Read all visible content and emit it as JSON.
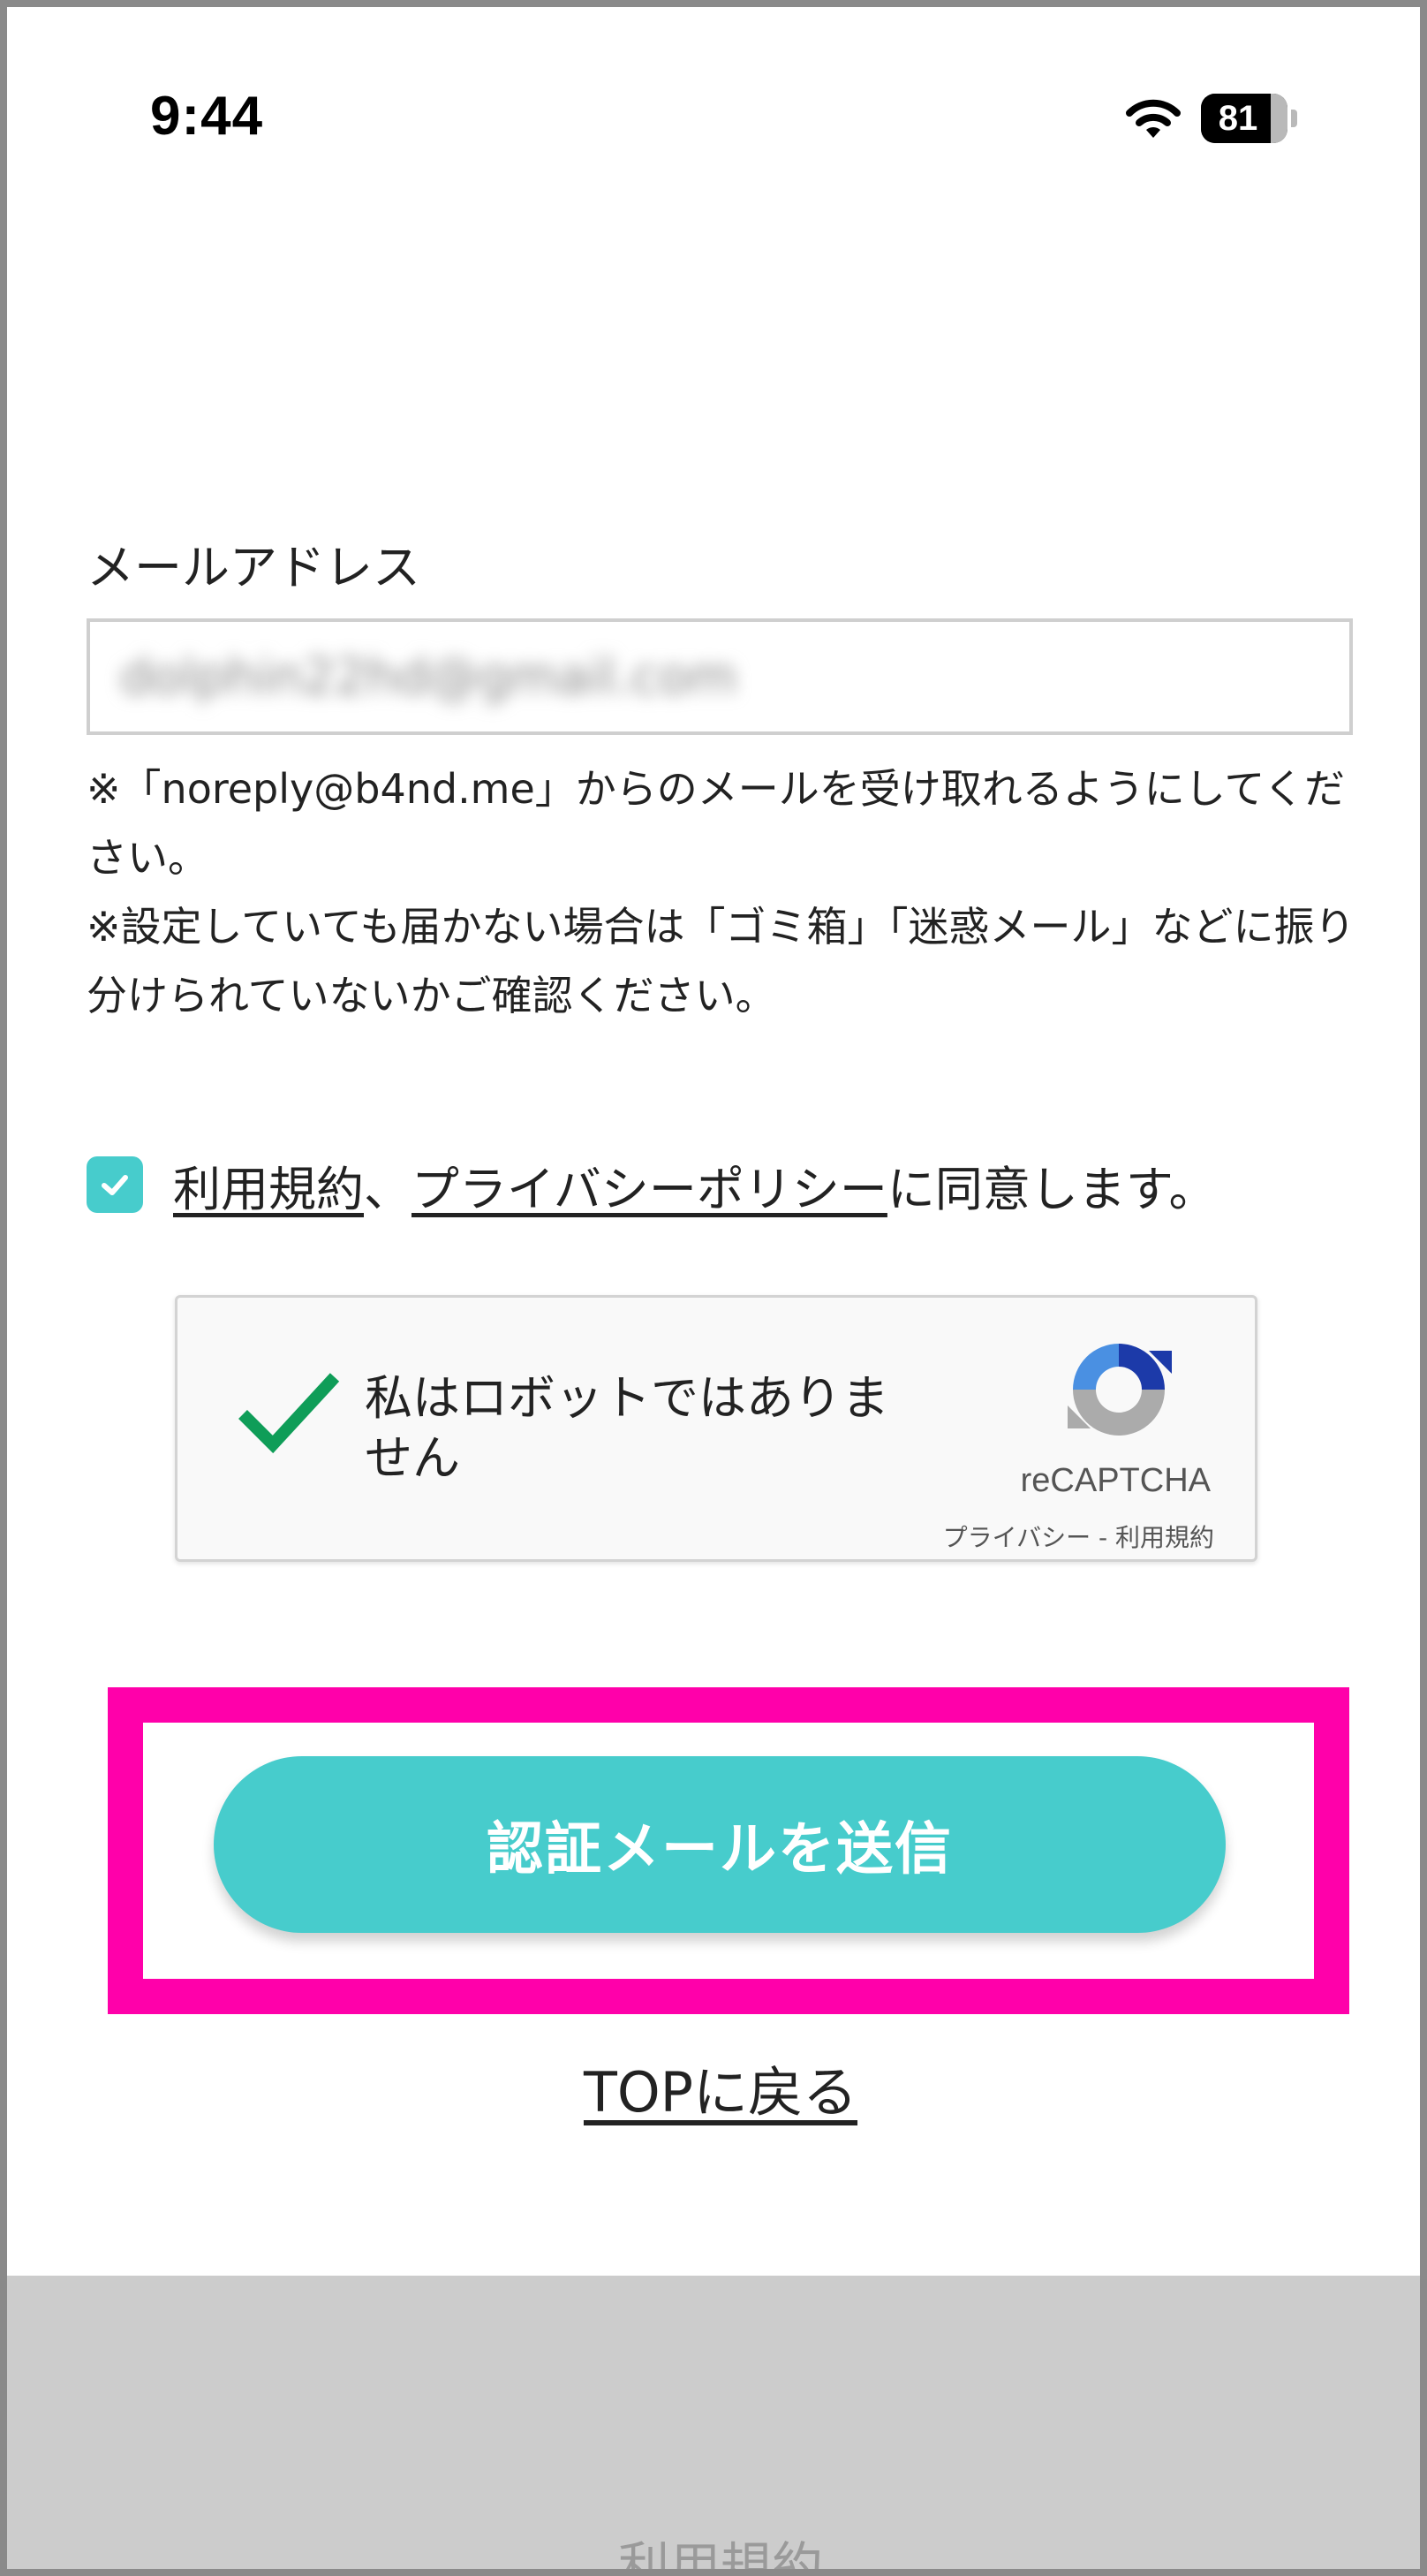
{
  "status_bar": {
    "time": "9:44",
    "battery_level": "81",
    "battery_fraction": 0.81
  },
  "email": {
    "label": "メールアドレス",
    "value": "dolphin22hd@gmail.com"
  },
  "notes": [
    "※「noreply@b4nd.me」からのメールを受け取れるようにしてください。",
    "※設定していても届かない場合は「ゴミ箱」「迷惑メール」などに振り分けられていないかご確認ください。"
  ],
  "agree": {
    "checked": true,
    "terms_link": "利用規約",
    "separator": "、",
    "privacy_link": "プライバシーポリシー",
    "suffix": "に同意します。"
  },
  "recaptcha": {
    "label": "私はロボットではありません",
    "brand": "reCAPTCHA",
    "privacy": "プライバシー",
    "separator": " - ",
    "terms": "利用規約"
  },
  "submit_button": "認証メールを送信",
  "top_link": "TOPに戻る",
  "footer": {
    "terms_link": "利用規約"
  },
  "colors": {
    "accent": "#47cccc",
    "highlight": "#ff00aa",
    "footer_bg": "#cccccc"
  }
}
